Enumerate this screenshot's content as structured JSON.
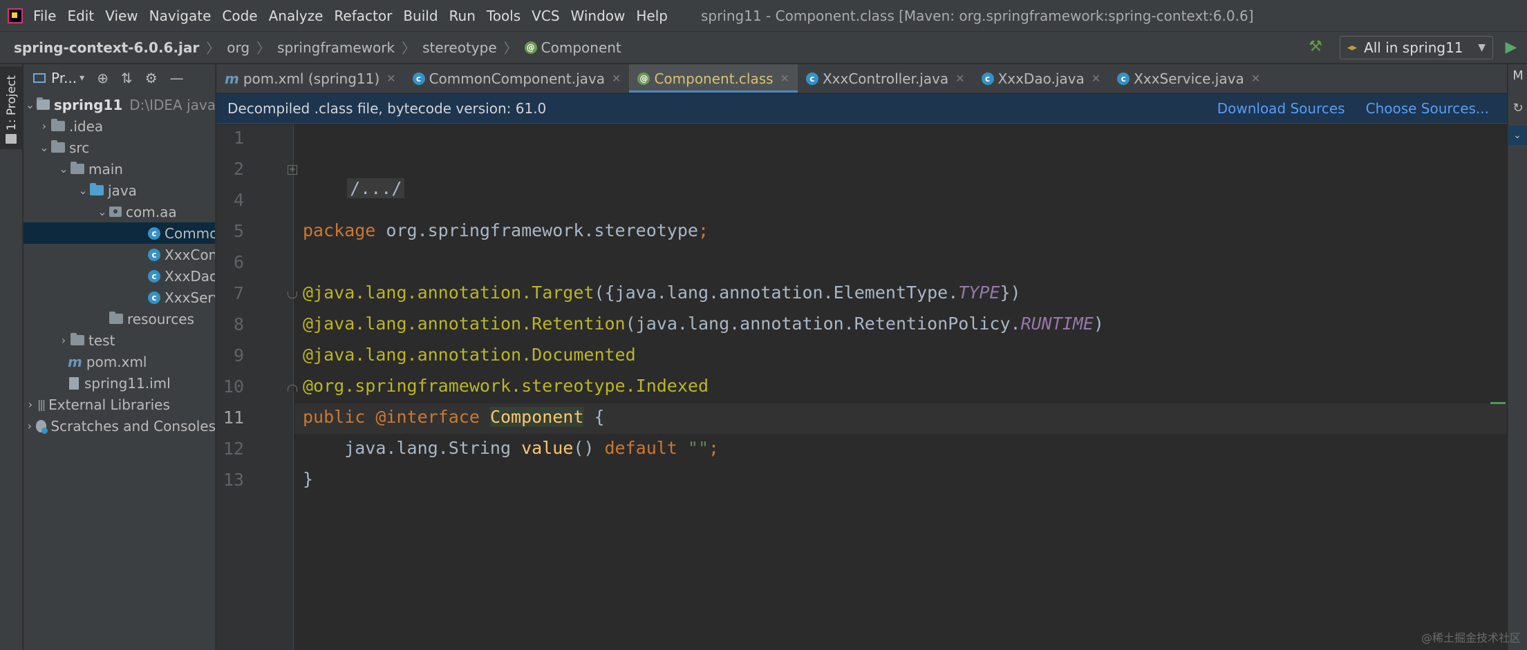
{
  "menubar": {
    "items": [
      "File",
      "Edit",
      "View",
      "Navigate",
      "Code",
      "Analyze",
      "Refactor",
      "Build",
      "Run",
      "Tools",
      "VCS",
      "Window",
      "Help"
    ],
    "window_title": "spring11 - Component.class [Maven: org.springframework:spring-context:6.0.6]"
  },
  "navbar": {
    "crumbs": [
      "spring-context-6.0.6.jar",
      "org",
      "springframework",
      "stereotype",
      "Component"
    ],
    "run_config": "All in spring11"
  },
  "left_strip": {
    "label": "1: Project"
  },
  "project_panel": {
    "title": "Pr...",
    "tree": [
      {
        "label": "spring11",
        "extra": "D:\\IDEA java"
      },
      {
        "label": ".idea"
      },
      {
        "label": "src"
      },
      {
        "label": "main"
      },
      {
        "label": "java"
      },
      {
        "label": "com.aa"
      },
      {
        "label": "CommonComponent"
      },
      {
        "label": "XxxController"
      },
      {
        "label": "XxxDao"
      },
      {
        "label": "XxxService"
      },
      {
        "label": "resources"
      },
      {
        "label": "test"
      },
      {
        "label": "pom.xml"
      },
      {
        "label": "spring11.iml"
      },
      {
        "label": "External Libraries"
      },
      {
        "label": "Scratches and Consoles"
      }
    ]
  },
  "tabs": [
    {
      "label": "pom.xml (spring11)",
      "icon": "maven-icon"
    },
    {
      "label": "CommonComponent.java",
      "icon": "class-icon"
    },
    {
      "label": "Component.class",
      "icon": "annotation-icon",
      "active": true
    },
    {
      "label": "XxxController.java",
      "icon": "class-icon"
    },
    {
      "label": "XxxDao.java",
      "icon": "class-icon"
    },
    {
      "label": "XxxService.java",
      "icon": "class-icon"
    }
  ],
  "banner": {
    "message": "Decompiled .class file, bytecode version: 61.0",
    "download_sources": "Download Sources",
    "choose_sources": "Choose Sources..."
  },
  "editor": {
    "line_numbers": [
      "1",
      "2",
      "4",
      "5",
      "6",
      "7",
      "8",
      "9",
      "10",
      "11",
      "12",
      "13"
    ],
    "current_line": "11",
    "code": {
      "l2_folded": "/.../",
      "l5_kw": "package",
      "l5_rest": " org.springframework.stereotype",
      "l5_semi": ";",
      "l7_a": "@java.lang.annotation.",
      "l7_b": "Target",
      "l7_c": "({java.lang.annotation.ElementType.",
      "l7_d": "TYPE",
      "l7_e": "})",
      "l8_a": "@java.lang.annotation.",
      "l8_b": "Retention",
      "l8_c": "(java.lang.annotation.RetentionPolicy.",
      "l8_d": "RUNTIME",
      "l8_e": ")",
      "l9_a": "@java.lang.annotation.",
      "l9_b": "Documented",
      "l10_a": "@org.springframework.stereotype.",
      "l10_b": "Indexed",
      "l11_kw1": "public",
      "l11_kw2": " @interface ",
      "l11_name": "Component",
      "l11_brace": " {",
      "l12_indent": "    java.lang.String ",
      "l12_fn": "value",
      "l12_paren": "() ",
      "l12_kw": "default",
      "l12_sp": " ",
      "l12_str": "\"\"",
      "l12_semi": ";",
      "l13": "}"
    }
  },
  "right_strip": {
    "label": "M"
  },
  "watermark": "@稀土掘金技术社区",
  "colors": {
    "keyword": "#cc7832",
    "annotation": "#bbb529",
    "constant": "#9876aa",
    "function": "#ffc66d",
    "string": "#6a8759",
    "banner_link": "#589df6"
  }
}
